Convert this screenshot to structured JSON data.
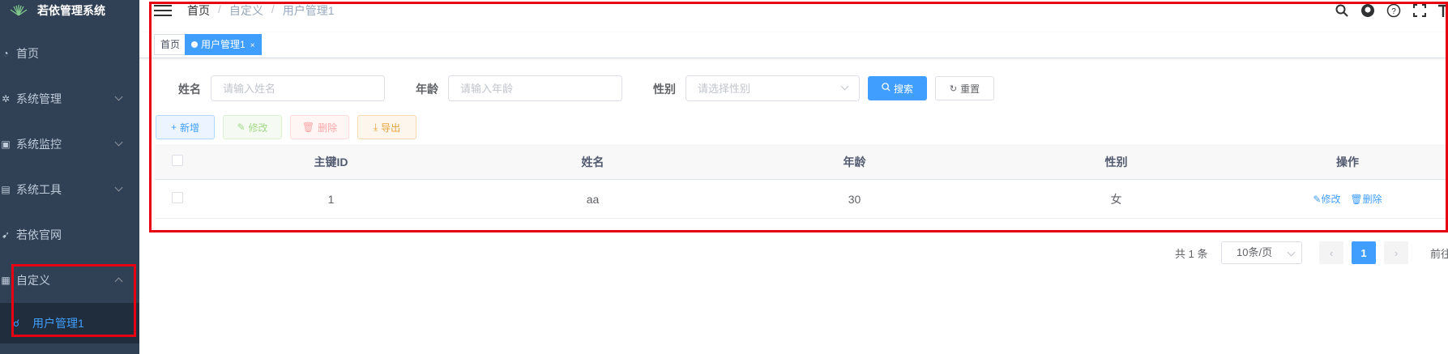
{
  "app": {
    "title": "若依管理系统"
  },
  "sidebar": {
    "items": [
      {
        "label": "首页",
        "icon": "dashboard-icon"
      },
      {
        "label": "系统管理",
        "icon": "gear-icon"
      },
      {
        "label": "系统监控",
        "icon": "monitor-icon"
      },
      {
        "label": "系统工具",
        "icon": "tool-icon"
      },
      {
        "label": "若依官网",
        "icon": "guide-icon"
      },
      {
        "label": "自定义",
        "icon": "table-icon"
      }
    ],
    "sub_item": {
      "label": "用户管理1",
      "icon": "user-icon"
    }
  },
  "navbar": {
    "breadcrumb": [
      "首页",
      "自定义",
      "用户管理1"
    ],
    "separator": "/"
  },
  "tags": [
    {
      "label": "首页",
      "active": false
    },
    {
      "label": "用户管理1",
      "active": true,
      "close": "×"
    }
  ],
  "search": {
    "name_label": "姓名",
    "name_placeholder": "请输入姓名",
    "age_label": "年龄",
    "age_placeholder": "请输入年龄",
    "gender_label": "性别",
    "gender_placeholder": "请选择性别",
    "search_button": "搜索",
    "reset_button": "重置"
  },
  "toolbar": {
    "add": "新增",
    "edit": "修改",
    "delete": "删除",
    "export": "导出"
  },
  "table": {
    "headers": [
      "主键ID",
      "姓名",
      "年龄",
      "性别",
      "操作"
    ],
    "rows": [
      {
        "id": "1",
        "name": "aa",
        "age": "30",
        "gender": "女",
        "edit": "修改",
        "delete": "删除"
      }
    ]
  },
  "pagination": {
    "total": "共 1 条",
    "page_size": "10条/页",
    "current_page": "1",
    "prev": "‹",
    "next": "›",
    "goto": "前往"
  },
  "colors": {
    "sidebar_bg": "#304156",
    "primary": "#409eff",
    "highlight_border": "#e60012"
  }
}
